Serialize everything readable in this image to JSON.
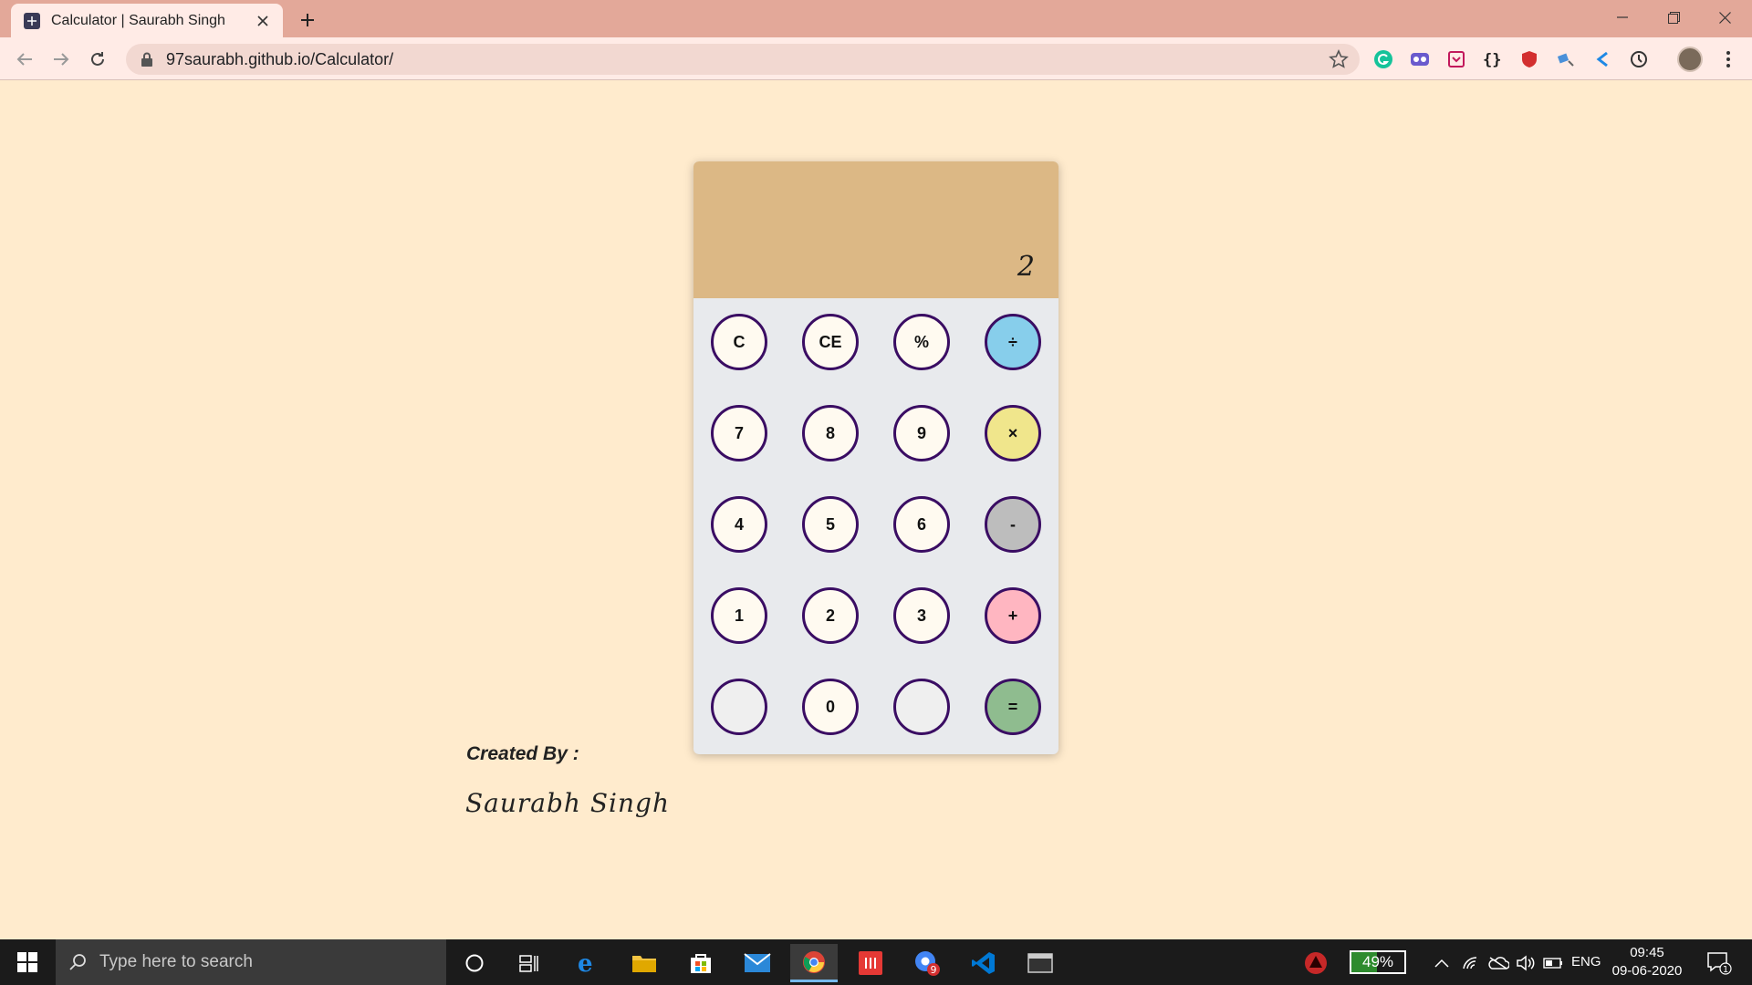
{
  "browser": {
    "tab_title": "Calculator | Saurabh Singh",
    "url": "97saurabh.github.io/Calculator/"
  },
  "calculator": {
    "display": "2",
    "keys": [
      {
        "label": "C",
        "color": "#fffaf0"
      },
      {
        "label": "CE",
        "color": "#fffaf0"
      },
      {
        "label": "%",
        "color": "#fffaf0"
      },
      {
        "label": "÷",
        "color": "#87ceeb"
      },
      {
        "label": "7",
        "color": "#fffaf0"
      },
      {
        "label": "8",
        "color": "#fffaf0"
      },
      {
        "label": "9",
        "color": "#fffaf0"
      },
      {
        "label": "×",
        "color": "#f0e68c"
      },
      {
        "label": "4",
        "color": "#fffaf0"
      },
      {
        "label": "5",
        "color": "#fffaf0"
      },
      {
        "label": "6",
        "color": "#fffaf0"
      },
      {
        "label": "-",
        "color": "#bdbdbd"
      },
      {
        "label": "1",
        "color": "#fffaf0"
      },
      {
        "label": "2",
        "color": "#fffaf0"
      },
      {
        "label": "3",
        "color": "#fffaf0"
      },
      {
        "label": "+",
        "color": "#ffb6c1"
      },
      {
        "label": "",
        "color": "#efefef"
      },
      {
        "label": "0",
        "color": "#fffaf0"
      },
      {
        "label": "",
        "color": "#efefef"
      },
      {
        "label": "=",
        "color": "#8fbc8f"
      }
    ]
  },
  "credits": {
    "label": "Created By :",
    "name": "Saurabh Singh"
  },
  "taskbar": {
    "search_placeholder": "Type here to search",
    "battery": "49%",
    "battery_level": 0.49,
    "language": "ENG",
    "time": "09:45",
    "date": "09-06-2020",
    "chrome_badge": "9",
    "notification_count": "1"
  }
}
